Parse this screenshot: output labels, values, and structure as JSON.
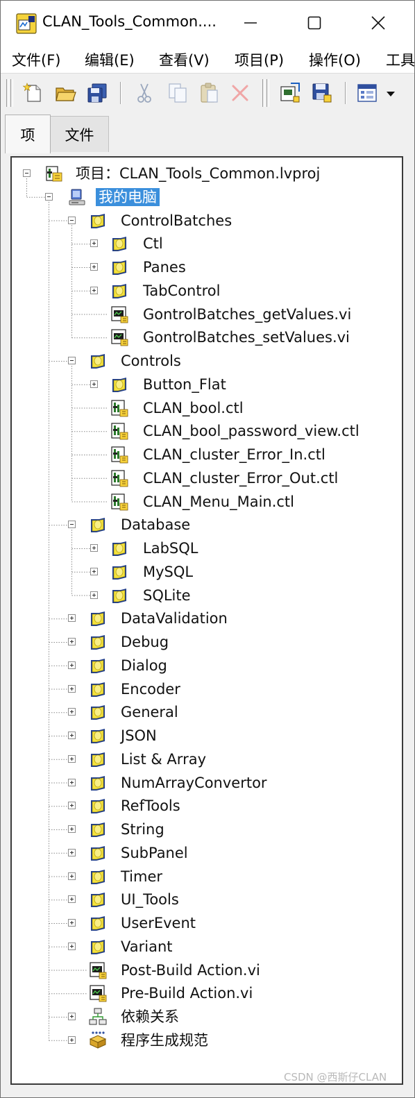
{
  "window": {
    "title": "CLAN_Tools_Common....",
    "minimize_glyph": "—",
    "maximize_glyph": "☐",
    "close_glyph": "✕"
  },
  "menu": [
    "文件(F)",
    "编辑(E)",
    "查看(V)",
    "项目(P)",
    "操作(O)",
    "工具"
  ],
  "toolbar_icons": [
    "new-icon",
    "open-folder-icon",
    "save-all-icon",
    "cut-icon",
    "copy-icon",
    "paste-icon",
    "delete-icon",
    "project-vi-icon",
    "save-project-icon",
    "view-options-icon",
    "dropdown-arrow-icon"
  ],
  "tabs": [
    "项",
    "文件"
  ],
  "tree": [
    {
      "label": "项目：CLAN_Tools_Common.lvproj",
      "type": "project",
      "depth": 0,
      "toggle": "minus"
    },
    {
      "label": "我的电脑",
      "type": "computer",
      "depth": 1,
      "toggle": "minus",
      "selected": true
    },
    {
      "label": "ControlBatches",
      "type": "folder",
      "depth": 2,
      "toggle": "minus"
    },
    {
      "label": "Ctl",
      "type": "folder",
      "depth": 3,
      "toggle": "plus"
    },
    {
      "label": "Panes",
      "type": "folder",
      "depth": 3,
      "toggle": "plus"
    },
    {
      "label": "TabControl",
      "type": "folder",
      "depth": 3,
      "toggle": "plus"
    },
    {
      "label": "GontrolBatches_getValues.vi",
      "type": "vi",
      "depth": 3,
      "toggle": "none"
    },
    {
      "label": "GontrolBatches_setValues.vi",
      "type": "vi",
      "depth": 3,
      "toggle": "none"
    },
    {
      "label": "Controls",
      "type": "folder",
      "depth": 2,
      "toggle": "minus"
    },
    {
      "label": "Button_Flat",
      "type": "folder",
      "depth": 3,
      "toggle": "plus"
    },
    {
      "label": "CLAN_bool.ctl",
      "type": "ctl",
      "depth": 3,
      "toggle": "none"
    },
    {
      "label": "CLAN_bool_password_view.ctl",
      "type": "ctl",
      "depth": 3,
      "toggle": "none"
    },
    {
      "label": "CLAN_cluster_Error_In.ctl",
      "type": "ctl",
      "depth": 3,
      "toggle": "none"
    },
    {
      "label": "CLAN_cluster_Error_Out.ctl",
      "type": "ctl",
      "depth": 3,
      "toggle": "none"
    },
    {
      "label": "CLAN_Menu_Main.ctl",
      "type": "ctl",
      "depth": 3,
      "toggle": "none"
    },
    {
      "label": "Database",
      "type": "folder",
      "depth": 2,
      "toggle": "minus"
    },
    {
      "label": "LabSQL",
      "type": "folder",
      "depth": 3,
      "toggle": "plus"
    },
    {
      "label": "MySQL",
      "type": "folder",
      "depth": 3,
      "toggle": "plus"
    },
    {
      "label": "SQLite",
      "type": "folder",
      "depth": 3,
      "toggle": "plus"
    },
    {
      "label": "DataValidation",
      "type": "folder",
      "depth": 2,
      "toggle": "plus"
    },
    {
      "label": "Debug",
      "type": "folder",
      "depth": 2,
      "toggle": "plus"
    },
    {
      "label": "Dialog",
      "type": "folder",
      "depth": 2,
      "toggle": "plus"
    },
    {
      "label": "Encoder",
      "type": "folder",
      "depth": 2,
      "toggle": "plus"
    },
    {
      "label": "General",
      "type": "folder",
      "depth": 2,
      "toggle": "plus"
    },
    {
      "label": "JSON",
      "type": "folder",
      "depth": 2,
      "toggle": "plus"
    },
    {
      "label": "List & Array",
      "type": "folder",
      "depth": 2,
      "toggle": "plus"
    },
    {
      "label": "NumArrayConvertor",
      "type": "folder",
      "depth": 2,
      "toggle": "plus"
    },
    {
      "label": "RefTools",
      "type": "folder",
      "depth": 2,
      "toggle": "plus"
    },
    {
      "label": "String",
      "type": "folder",
      "depth": 2,
      "toggle": "plus"
    },
    {
      "label": "SubPanel",
      "type": "folder",
      "depth": 2,
      "toggle": "plus"
    },
    {
      "label": "Timer",
      "type": "folder",
      "depth": 2,
      "toggle": "plus"
    },
    {
      "label": "UI_Tools",
      "type": "folder",
      "depth": 2,
      "toggle": "plus"
    },
    {
      "label": "UserEvent",
      "type": "folder",
      "depth": 2,
      "toggle": "plus"
    },
    {
      "label": "Variant",
      "type": "folder",
      "depth": 2,
      "toggle": "plus"
    },
    {
      "label": "Post-Build Action.vi",
      "type": "vi",
      "depth": 2,
      "toggle": "none"
    },
    {
      "label": "Pre-Build Action.vi",
      "type": "vi",
      "depth": 2,
      "toggle": "none"
    },
    {
      "label": "依赖关系",
      "type": "dependencies",
      "depth": 2,
      "toggle": "plus"
    },
    {
      "label": "程序生成规范",
      "type": "build-spec",
      "depth": 2,
      "toggle": "plus"
    }
  ],
  "watermark": "CSDN @西斯仔CLAN",
  "colors": {
    "selection": "#3b8fdc",
    "folder": "#f2e33a",
    "folder_border": "#1f3d8a"
  }
}
